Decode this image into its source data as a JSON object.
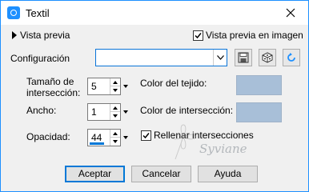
{
  "window": {
    "title": "Textil",
    "accent": "#1e90ff"
  },
  "preview": {
    "toggle_label": "Vista previa",
    "image_preview_label": "Vista previa en imagen",
    "image_preview_checked": true
  },
  "config": {
    "label": "Configuración",
    "value": ""
  },
  "toolbar": {
    "icons": [
      "save-icon",
      "randomize-dice-icon",
      "reset-icon"
    ]
  },
  "params": {
    "size": {
      "label_line1": "Tamaño de",
      "label_line2": "intersección:",
      "value": "5"
    },
    "width": {
      "label": "Ancho:",
      "value": "1"
    },
    "opacity": {
      "label": "Opacidad:",
      "value": "44"
    }
  },
  "colors": {
    "fabric_label": "Color del tejido:",
    "fabric_color": "#a8bfd8",
    "intersection_label": "Color de intersección:",
    "intersection_color": "#a8bfd8"
  },
  "fill": {
    "label": "Rellenar intersecciones",
    "checked": true
  },
  "buttons": {
    "accept": "Aceptar",
    "cancel": "Cancelar",
    "help": "Ayuda"
  },
  "watermark": {
    "text": "Syviane"
  }
}
